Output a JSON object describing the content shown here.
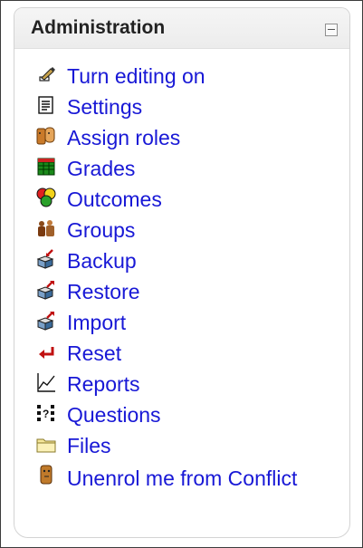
{
  "block": {
    "title": "Administration",
    "collapse_icon": "minus-box-icon",
    "items": [
      {
        "label": "Turn editing on",
        "icon": "edit-pencil-icon"
      },
      {
        "label": "Settings",
        "icon": "settings-document-icon"
      },
      {
        "label": "Assign roles",
        "icon": "assign-roles-icon"
      },
      {
        "label": "Grades",
        "icon": "grades-grid-icon"
      },
      {
        "label": "Outcomes",
        "icon": "outcomes-circles-icon"
      },
      {
        "label": "Groups",
        "icon": "groups-people-icon"
      },
      {
        "label": "Backup",
        "icon": "backup-box-icon"
      },
      {
        "label": "Restore",
        "icon": "restore-box-icon"
      },
      {
        "label": "Import",
        "icon": "import-box-icon"
      },
      {
        "label": "Reset",
        "icon": "reset-arrow-icon"
      },
      {
        "label": "Reports",
        "icon": "reports-graph-icon"
      },
      {
        "label": "Questions",
        "icon": "questions-icon"
      },
      {
        "label": "Files",
        "icon": "folder-icon"
      },
      {
        "label": "Unenrol me from Conflict",
        "icon": "unenrol-person-icon"
      }
    ]
  }
}
